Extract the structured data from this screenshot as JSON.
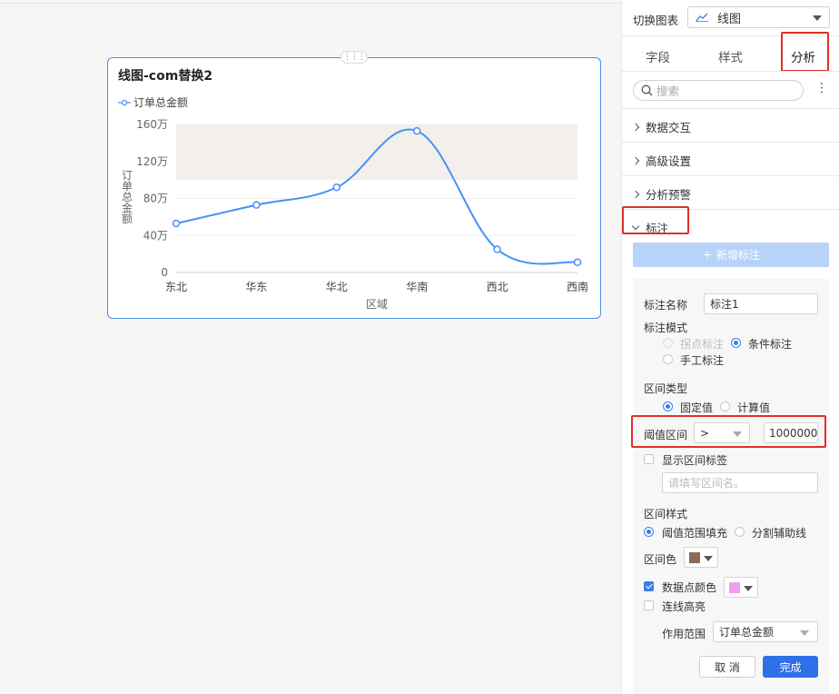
{
  "chart_card": {
    "title": "线图-com替换2",
    "handle_icon": "drag-handle-icon"
  },
  "chart_data": {
    "type": "line",
    "title": "线图-com替换2",
    "categories": [
      "东北",
      "华东",
      "华北",
      "华南",
      "西北",
      "西南"
    ],
    "series": [
      {
        "name": "订单总金额",
        "values": [
          53,
          73,
          92,
          153,
          25,
          11
        ],
        "color": "#4a8ff7"
      }
    ],
    "y_unit": "万",
    "ylim": [
      0,
      160
    ],
    "y_ticks": [
      "160万",
      "120万",
      "80万",
      "40万",
      "0"
    ],
    "y_tick_values": [
      160,
      120,
      80,
      40,
      0
    ],
    "xlabel": "区域",
    "ylabel": "订单总金额",
    "grid": true,
    "legend": "top-left",
    "annotation_band": {
      "from": 100,
      "to": 160,
      "color": "#f3efeb"
    }
  },
  "panel": {
    "switch_chart_label": "切换图表",
    "chart_type_value": "线图",
    "tabs": [
      {
        "label": "字段"
      },
      {
        "label": "样式"
      },
      {
        "label": "分析"
      }
    ],
    "search_placeholder": "搜索",
    "more_icon": "⋮",
    "accordion": [
      {
        "label": "数据交互"
      },
      {
        "label": "高级设置"
      },
      {
        "label": "分析预警"
      },
      {
        "label": "标注"
      }
    ],
    "add_annotation": "＋ 新增标注",
    "form": {
      "name_label": "标注名称",
      "name_value": "标注1",
      "mode_label": "标注模式",
      "mode_opt1": "拐点标注",
      "mode_opt2": "条件标注",
      "mode_opt3": "手工标注",
      "range_type_label": "区间类型",
      "range_opt1": "固定值",
      "range_opt2": "计算值",
      "threshold_label": "阈值区间",
      "threshold_op": ">",
      "threshold_value": "1000000",
      "show_label": "显示区间标签",
      "label_placeholder": "请填写区间名。",
      "style_label": "区间样式",
      "style_opt1": "阈值范围填充",
      "style_opt2": "分割辅助线",
      "color_label": "区间色",
      "color_value": "#8b6a5a",
      "point_color_label": "数据点颜色",
      "point_color_value": "#f09ef0",
      "highlight_label": "连线高亮",
      "scope_label": "作用范围",
      "scope_value": "订单总金额",
      "cancel": "取 消",
      "done": "完成"
    }
  }
}
